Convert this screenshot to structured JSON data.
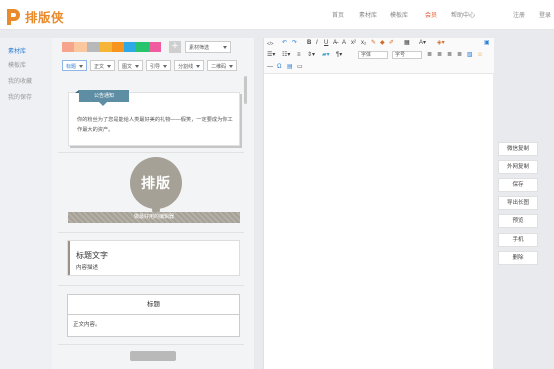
{
  "app": {
    "logo_text": "排版侠",
    "brand_color": "#e98a2b"
  },
  "nav": {
    "items": [
      {
        "label": "首页"
      },
      {
        "label": "素材库"
      },
      {
        "label": "模板库"
      },
      {
        "label": "会员"
      },
      {
        "label": "帮助中心"
      }
    ],
    "register": "注册",
    "login": "登录",
    "active_color": "#e9572f"
  },
  "leftmenu": {
    "items": [
      {
        "label": "素材库",
        "active": true
      },
      {
        "label": "模板库"
      },
      {
        "label": "我的收藏"
      },
      {
        "label": "我的保存"
      }
    ]
  },
  "materials": {
    "colors": [
      "#f6a58c",
      "#fbc79f",
      "#b8b8b8",
      "#f7b538",
      "#f7941e",
      "#2ea9e6",
      "#27c36d",
      "#f15ca0"
    ],
    "add_symbol": "+",
    "filter_label": "素材筛选",
    "tabs": [
      {
        "label": "标题",
        "active": true
      },
      {
        "label": "正文"
      },
      {
        "label": "图文"
      },
      {
        "label": "引导"
      },
      {
        "label": "分割线"
      },
      {
        "label": "二维码"
      }
    ]
  },
  "cards": {
    "notice_tag": "公告通知",
    "notice_text": "你的粉丝为了您是能给人类最好美的礼物——假笑，一定要成为你工作最大的资产。",
    "banner_text": "排版",
    "banner_sub": "做最好用的编辑器",
    "title_text": "标题文字",
    "desc_text": "内容描述",
    "table_head": "标题",
    "table_body": "正文内容。"
  },
  "editor": {
    "font_label": "字体",
    "size_label": "字号"
  },
  "actions": {
    "buttons": [
      {
        "label": "微信复制"
      },
      {
        "label": "外网复制"
      },
      {
        "label": "保存"
      },
      {
        "label": "导出长图"
      },
      {
        "label": "预览"
      },
      {
        "label": "手机"
      },
      {
        "label": "删除"
      }
    ]
  }
}
